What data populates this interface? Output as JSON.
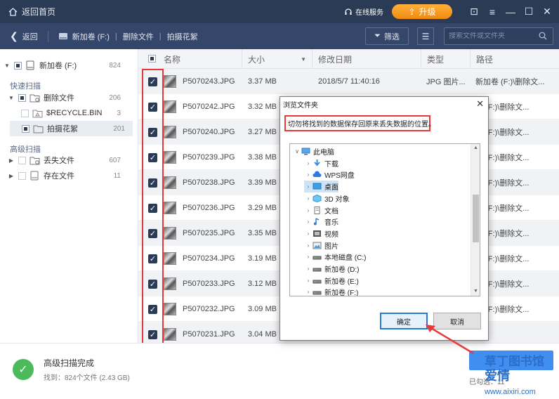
{
  "topbar": {
    "home_label": "返回首页",
    "service_label": "在线服务",
    "upgrade_label": "升级"
  },
  "navbar": {
    "back_label": "返回",
    "crumbs": [
      "新加卷 (F:)",
      "删除文件",
      "拍摄花絮"
    ],
    "filter_label": "筛选",
    "search_placeholder": "搜索文件或文件夹"
  },
  "sidebar": {
    "root": {
      "label": "新加卷 (F:)",
      "count": "824"
    },
    "quick_scan_label": "快速扫描",
    "deleted_files": {
      "label": "删除文件",
      "count": "206"
    },
    "recycle_bin": {
      "label": "$RECYCLE.BIN",
      "count": "3"
    },
    "photo_outtakes": {
      "label": "拍摄花絮",
      "count": "201"
    },
    "advanced_scan_label": "高级扫描",
    "lost_files": {
      "label": "丢失文件",
      "count": "607"
    },
    "existing_files": {
      "label": "存在文件",
      "count": "11"
    }
  },
  "table": {
    "headers": [
      "名称",
      "大小",
      "修改日期",
      "类型",
      "路径"
    ],
    "rows": [
      {
        "name": "P5070243.JPG",
        "size": "3.37 MB",
        "date": "2018/5/7 11:40:16",
        "type": "JPG 图片...",
        "path": "新加卷 (F:)\\删除文..."
      },
      {
        "name": "P5070242.JPG",
        "size": "3.32 MB",
        "date": "",
        "type": "",
        "path": "卷 (F:)\\删除文..."
      },
      {
        "name": "P5070240.JPG",
        "size": "3.27 MB",
        "date": "",
        "type": "",
        "path": "卷 (F:)\\删除文..."
      },
      {
        "name": "P5070239.JPG",
        "size": "3.38 MB",
        "date": "",
        "type": "",
        "path": "卷 (F:)\\删除文..."
      },
      {
        "name": "P5070238.JPG",
        "size": "3.39 MB",
        "date": "",
        "type": "",
        "path": "卷 (F:)\\删除文..."
      },
      {
        "name": "P5070236.JPG",
        "size": "3.29 MB",
        "date": "",
        "type": "",
        "path": "卷 (F:)\\删除文..."
      },
      {
        "name": "P5070235.JPG",
        "size": "3.35 MB",
        "date": "",
        "type": "",
        "path": "卷 (F:)\\删除文..."
      },
      {
        "name": "P5070234.JPG",
        "size": "3.19 MB",
        "date": "",
        "type": "",
        "path": "卷 (F:)\\删除文..."
      },
      {
        "name": "P5070233.JPG",
        "size": "3.12 MB",
        "date": "",
        "type": "",
        "path": "卷 (F:)\\删除文..."
      },
      {
        "name": "P5070232.JPG",
        "size": "3.09 MB",
        "date": "",
        "type": "",
        "path": "卷 (F:)\\删除文..."
      },
      {
        "name": "P5070231.JPG",
        "size": "3.04 MB",
        "date": "2018/5/7 11:40:10",
        "type": "",
        "path": ""
      }
    ]
  },
  "bottom": {
    "status_title": "高级扫描完成",
    "status_sub": "找到：824个文件 (2.43 GB)",
    "selected_info": "已勾选：11"
  },
  "dialog": {
    "title": "浏览文件夹",
    "message": "切勿将找到的数据保存回原来丢失数据的位置。",
    "tree": [
      {
        "label": "此电脑",
        "icon": "computer-icon"
      },
      {
        "label": "下载",
        "icon": "download-icon"
      },
      {
        "label": "WPS网盘",
        "icon": "cloud-icon"
      },
      {
        "label": "桌面",
        "icon": "desktop-icon"
      },
      {
        "label": "3D 对象",
        "icon": "cube-icon"
      },
      {
        "label": "文档",
        "icon": "document-icon"
      },
      {
        "label": "音乐",
        "icon": "music-icon"
      },
      {
        "label": "视频",
        "icon": "video-icon"
      },
      {
        "label": "图片",
        "icon": "picture-icon"
      },
      {
        "label": "本地磁盘 (C:)",
        "icon": "drive-icon"
      },
      {
        "label": "新加卷 (D:)",
        "icon": "drive-icon"
      },
      {
        "label": "新加卷 (E:)",
        "icon": "drive-icon"
      },
      {
        "label": "新加卷 (F:)",
        "icon": "drive-icon"
      }
    ],
    "ok_label": "确定",
    "cancel_label": "取消"
  },
  "watermark": {
    "line1": "草丁图书馆",
    "line2": "爱情",
    "url": "www.aixiri.com"
  },
  "colors": {
    "topbar": "#2b3a55",
    "navbar": "#34466a",
    "accent": "#3f8ef0",
    "upgrade": "#f5a623",
    "highlight_red": "#e63a3a",
    "success": "#4cba5a"
  }
}
